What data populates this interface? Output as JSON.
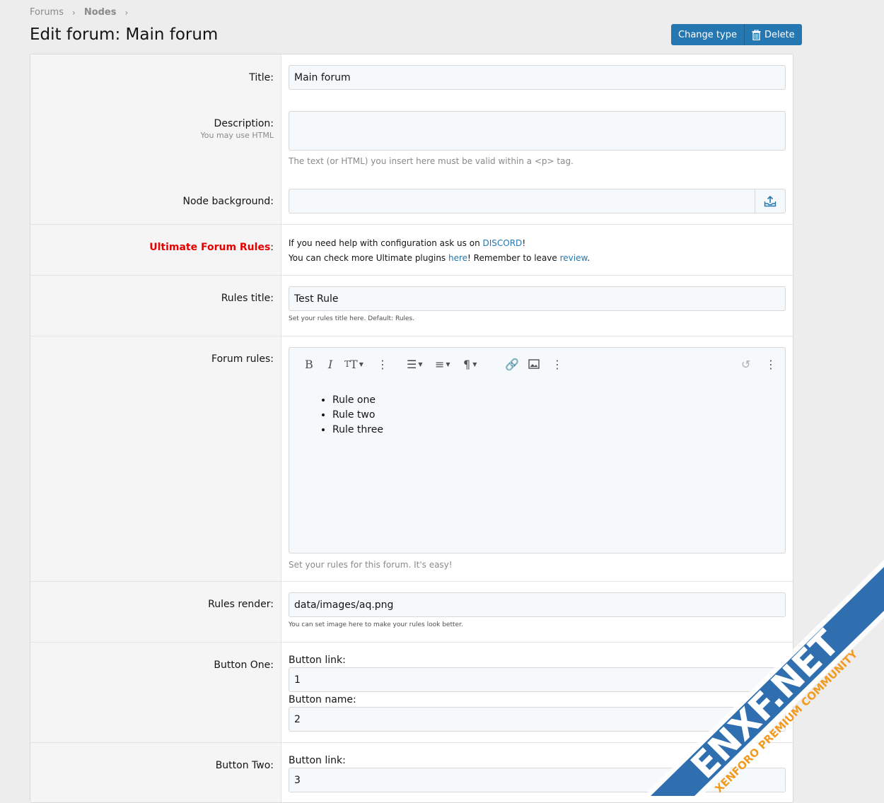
{
  "breadcrumb": {
    "items": [
      "Forums",
      "Nodes"
    ]
  },
  "page": {
    "title": "Edit forum: Main forum"
  },
  "actions": {
    "change_type": "Change type",
    "delete": "Delete"
  },
  "form": {
    "title": {
      "label": "Title:",
      "value": "Main forum"
    },
    "description": {
      "label": "Description:",
      "hint": "You may use HTML",
      "value": "",
      "explain": "The text (or HTML) you insert here must be valid within a <p> tag."
    },
    "node_background": {
      "label": "Node background:",
      "value": ""
    },
    "ultimate": {
      "label": "Ultimate Forum Rules",
      "colon": ":",
      "line1_prefix": "If you need help with configuration ask us on ",
      "line1_link": "DISCORD",
      "line1_suffix": "!",
      "line2_prefix": "You can check more Ultimate plugins ",
      "line2_link": "here",
      "line2_mid": "! Remember to leave ",
      "line2_link2": "review",
      "line2_suffix": "."
    },
    "rules_title": {
      "label": "Rules title:",
      "value": "Test Rule",
      "explain": "Set your rules title here. Default: Rules."
    },
    "forum_rules": {
      "label": "Forum rules:",
      "items": [
        "Rule one",
        "Rule two",
        "Rule three"
      ],
      "explain": "Set your rules for this forum. It's easy!"
    },
    "rules_render": {
      "label": "Rules render:",
      "value": "data/images/aq.png",
      "explain": "You can set image here to make your rules look better."
    },
    "button_one": {
      "label": "Button One:",
      "link_label": "Button link:",
      "link_value": "1",
      "name_label": "Button name:",
      "name_value": "2"
    },
    "button_two": {
      "label": "Button Two:",
      "link_label": "Button link:",
      "link_value": "3"
    }
  },
  "watermark": {
    "brand": "ENXF.NET",
    "tagline": "XENFORO PREMIUM COMMUNITY"
  },
  "colors": {
    "accent": "#2577b1",
    "highlight": "#e80000",
    "watermark_blue": "#2f6fb0",
    "watermark_orange": "#f29a1f"
  }
}
